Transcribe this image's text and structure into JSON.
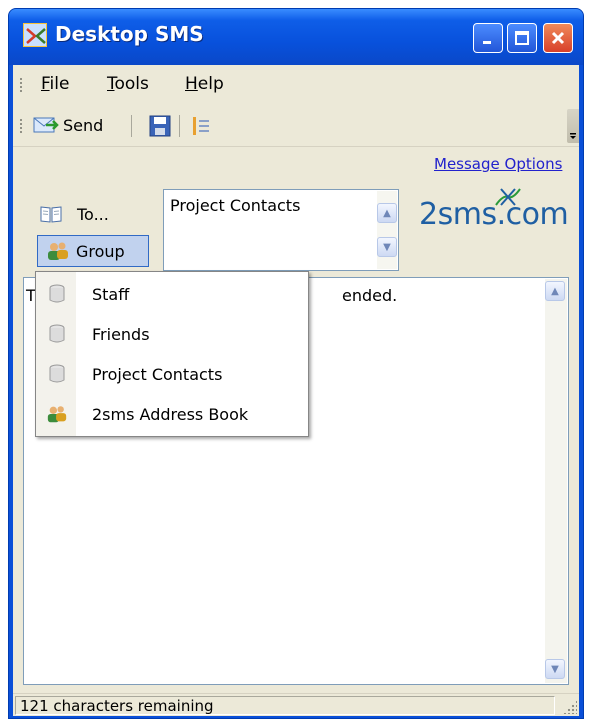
{
  "window": {
    "title": "Desktop SMS",
    "accent_color": "#0a4fd8",
    "close_color": "#d8402a"
  },
  "menubar": {
    "items": [
      {
        "label": "File",
        "accel": "F",
        "rest": "ile"
      },
      {
        "label": "Tools",
        "accel": "T",
        "rest": "ools"
      },
      {
        "label": "Help",
        "accel": "H",
        "rest": "elp"
      }
    ]
  },
  "toolbar": {
    "send_label": "Send",
    "icons": [
      "send-icon",
      "save-icon",
      "list-icon"
    ]
  },
  "message_options_link": "Message Options",
  "recipients": {
    "to_label": "To...",
    "group_label": "Group",
    "value": "Project Contacts"
  },
  "logo_text": "2sms.com",
  "message": {
    "visible_start": "T",
    "visible_end": "ended."
  },
  "group_menu": {
    "items": [
      {
        "label": "Staff",
        "icon": "group-icon"
      },
      {
        "label": "Friends",
        "icon": "group-icon"
      },
      {
        "label": "Project Contacts",
        "icon": "group-icon"
      },
      {
        "label": "2sms Address Book",
        "icon": "address-book-icon"
      }
    ]
  },
  "status": {
    "text": "121 characters remaining"
  }
}
